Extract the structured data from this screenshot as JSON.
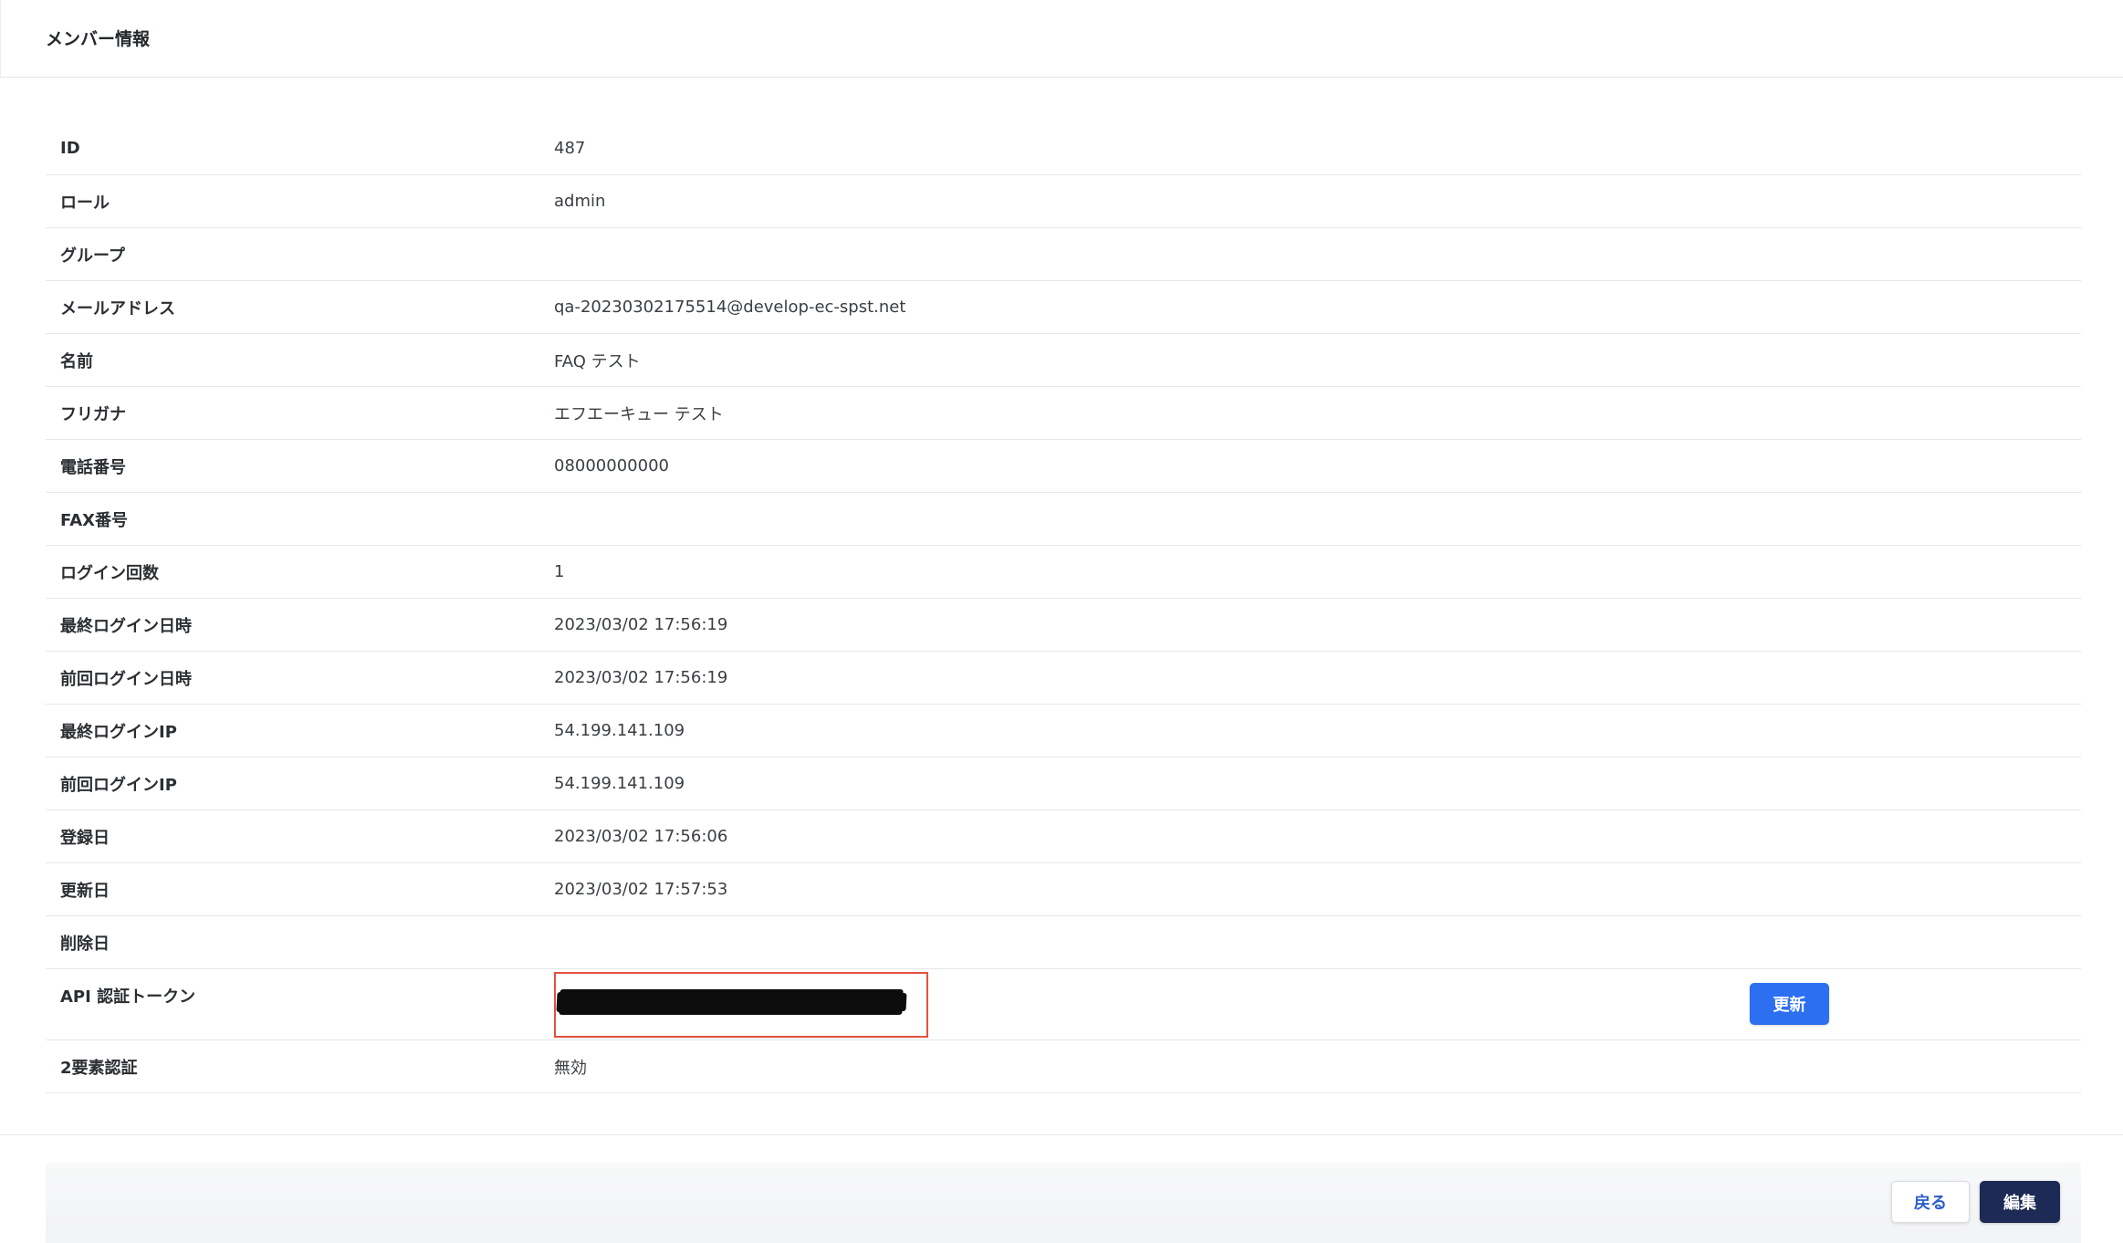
{
  "header": {
    "title": "メンバー情報"
  },
  "fields": [
    {
      "label": "ID",
      "value": "487"
    },
    {
      "label": "ロール",
      "value": "admin"
    },
    {
      "label": "グループ",
      "value": ""
    },
    {
      "label": "メールアドレス",
      "value": "qa-20230302175514@develop-ec-spst.net"
    },
    {
      "label": "名前",
      "value": "FAQ テスト"
    },
    {
      "label": "フリガナ",
      "value": "エフエーキュー テスト"
    },
    {
      "label": "電話番号",
      "value": "08000000000"
    },
    {
      "label": "FAX番号",
      "value": ""
    },
    {
      "label": "ログイン回数",
      "value": "1"
    },
    {
      "label": "最終ログイン日時",
      "value": "2023/03/02 17:56:19"
    },
    {
      "label": "前回ログイン日時",
      "value": "2023/03/02 17:56:19"
    },
    {
      "label": "最終ログインIP",
      "value": "54.199.141.109"
    },
    {
      "label": "前回ログインIP",
      "value": "54.199.141.109"
    },
    {
      "label": "登録日",
      "value": "2023/03/02 17:56:06"
    },
    {
      "label": "更新日",
      "value": "2023/03/02 17:57:53"
    },
    {
      "label": "削除日",
      "value": ""
    }
  ],
  "api_token": {
    "label": "API 認証トークン",
    "refresh_label": "更新"
  },
  "two_factor": {
    "label": "2要素認証",
    "value": "無効"
  },
  "footer": {
    "back_label": "戻る",
    "edit_label": "編集"
  },
  "colors": {
    "primary_button": "#2c6ff0",
    "edit_button": "#1c2a55",
    "highlight_border": "#e2513f"
  }
}
